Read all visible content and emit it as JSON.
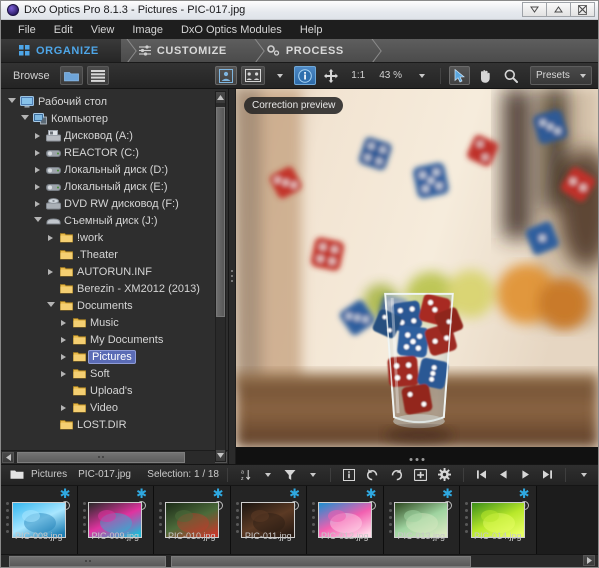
{
  "window": {
    "title": "DxO Optics Pro 8.1.3 - Pictures - PIC-017.jpg",
    "app_icon": "dxo-logo-icon",
    "buttons": [
      {
        "name": "minimize-button",
        "glyph": "minimize-icon"
      },
      {
        "name": "maximize-button",
        "glyph": "maximize-icon"
      },
      {
        "name": "close-button",
        "glyph": "close-icon"
      }
    ]
  },
  "menubar": {
    "items": [
      "File",
      "Edit",
      "View",
      "Image",
      "DxO Optics Modules",
      "Help"
    ]
  },
  "stages": [
    {
      "label": "ORGANIZE",
      "icon": "grid-icon",
      "active": true
    },
    {
      "label": "CUSTOMIZE",
      "icon": "sliders-icon",
      "active": false
    },
    {
      "label": "PROCESS",
      "icon": "gears-icon",
      "active": false
    }
  ],
  "toolbar": {
    "browse_label": "Browse",
    "folder_icon": "folder-icon",
    "list_icon": "list-view-icon",
    "single_view_icon": "single-image-view-icon",
    "compare_view_icon": "compare-image-view-icon",
    "compare_caret": "chevron-down-icon",
    "info_icon": "info-icon",
    "move_icon": "move-tool-icon",
    "one_to_one": "1:1",
    "zoom_value": "43 %",
    "zoom_caret": "chevron-down-icon",
    "pointer_icon": "pointer-tool-icon",
    "hand_icon": "hand-tool-icon",
    "magnifier_icon": "magnifier-tool-icon",
    "presets_label": "Presets",
    "presets_caret": "chevron-down-icon"
  },
  "tree": {
    "items": [
      {
        "label": "Рабочий стол",
        "depth": 0,
        "icon": "desktop-icon",
        "twisty": "open",
        "selected": false
      },
      {
        "label": "Компьютер",
        "depth": 1,
        "icon": "computer-icon",
        "twisty": "open",
        "selected": false
      },
      {
        "label": "Дисковод (A:)",
        "depth": 2,
        "icon": "floppy-icon",
        "twisty": "closed",
        "selected": false
      },
      {
        "label": "REACTOR (C:)",
        "depth": 2,
        "icon": "harddisk-icon",
        "twisty": "closed",
        "selected": false
      },
      {
        "label": "Локальный диск (D:)",
        "depth": 2,
        "icon": "harddisk-icon",
        "twisty": "closed",
        "selected": false
      },
      {
        "label": "Локальный диск (E:)",
        "depth": 2,
        "icon": "harddisk-icon",
        "twisty": "closed",
        "selected": false
      },
      {
        "label": "DVD RW дисковод (F:)",
        "depth": 2,
        "icon": "optical-icon",
        "twisty": "closed",
        "selected": false
      },
      {
        "label": "Съемный диск (J:)",
        "depth": 2,
        "icon": "removable-icon",
        "twisty": "open",
        "selected": false
      },
      {
        "label": "!work",
        "depth": 3,
        "icon": "folder-icon",
        "twisty": "closed",
        "selected": false
      },
      {
        "label": ".Theater",
        "depth": 3,
        "icon": "folder-icon",
        "twisty": "none",
        "selected": false
      },
      {
        "label": "AUTORUN.INF",
        "depth": 3,
        "icon": "folder-icon",
        "twisty": "closed",
        "selected": false
      },
      {
        "label": "Berezin - XM2012 (2013)",
        "depth": 3,
        "icon": "folder-icon",
        "twisty": "none",
        "selected": false
      },
      {
        "label": "Documents",
        "depth": 3,
        "icon": "folder-icon",
        "twisty": "open",
        "selected": false
      },
      {
        "label": "Music",
        "depth": 4,
        "icon": "folder-icon",
        "twisty": "closed",
        "selected": false
      },
      {
        "label": "My Documents",
        "depth": 4,
        "icon": "folder-icon",
        "twisty": "closed",
        "selected": false
      },
      {
        "label": "Pictures",
        "depth": 4,
        "icon": "folder-icon",
        "twisty": "closed",
        "selected": true
      },
      {
        "label": "Soft",
        "depth": 4,
        "icon": "folder-icon",
        "twisty": "closed",
        "selected": false
      },
      {
        "label": "Upload's",
        "depth": 4,
        "icon": "folder-icon",
        "twisty": "none",
        "selected": false
      },
      {
        "label": "Video",
        "depth": 4,
        "icon": "folder-icon",
        "twisty": "closed",
        "selected": false
      },
      {
        "label": "LOST.DIR",
        "depth": 3,
        "icon": "folder-icon",
        "twisty": "none",
        "selected": false
      }
    ]
  },
  "preview": {
    "badge": "Correction preview",
    "image_description": "red and blue dice falling into a glass tumbler"
  },
  "stripbar": {
    "folder_icon": "folder-icon",
    "folder_name": "Pictures",
    "file_name": "PIC-017.jpg",
    "selection_label": "Selection: 1 / 18",
    "sort_icon": "sort-az-icon",
    "sort_caret": "chevron-down-icon",
    "filter_icon": "filter-funnel-icon",
    "filter_caret": "chevron-down-icon",
    "info_icon": "info-icon",
    "rotate_left_icon": "rotate-left-icon",
    "rotate_right_icon": "rotate-right-icon",
    "add_icon": "add-plus-icon",
    "settings_icon": "gear-icon",
    "nav_first_icon": "nav-first-icon",
    "nav_prev_icon": "nav-previous-icon",
    "nav_next_icon": "nav-next-icon",
    "nav_last_icon": "nav-last-icon",
    "overflow_caret": "chevron-down-icon"
  },
  "thumbnails": [
    {
      "name": "PIC-008.jpg",
      "starred": true,
      "rating_dots": 5,
      "colors": [
        "#35b7ef",
        "#a8e6ff",
        "#1f7fb5"
      ]
    },
    {
      "name": "PIC-009.jpg",
      "starred": true,
      "rating_dots": 5,
      "colors": [
        "#2a2a2a",
        "#e033a0",
        "#23b7d6"
      ]
    },
    {
      "name": "PIC-010.jpg",
      "starred": true,
      "rating_dots": 5,
      "colors": [
        "#1c2c18",
        "#4c6b3a",
        "#c23a2a"
      ]
    },
    {
      "name": "PIC-011.jpg",
      "starred": true,
      "rating_dots": 5,
      "colors": [
        "#1a1410",
        "#5c3a24",
        "#2a1c14"
      ]
    },
    {
      "name": "PIC-012.jpg",
      "starred": true,
      "rating_dots": 5,
      "colors": [
        "#1a8fd0",
        "#f25fb0",
        "#ffd8e8"
      ]
    },
    {
      "name": "PIC-013.jpg",
      "starred": true,
      "rating_dots": 5,
      "colors": [
        "#2f4a22",
        "#9fd4a0",
        "#d8e8c0"
      ]
    },
    {
      "name": "PIC-014.jpg",
      "starred": true,
      "rating_dots": 5,
      "colors": [
        "#3c8f1a",
        "#b8e82a",
        "#e8ff66"
      ]
    }
  ],
  "colors": {
    "accent_blue": "#2fa8e0",
    "active_tab_text": "#4ea6e8",
    "panel_bg": "#2e2e2e",
    "toolbar_bg": "#2b2b2b",
    "selection_blue": "#5a6bb5"
  }
}
